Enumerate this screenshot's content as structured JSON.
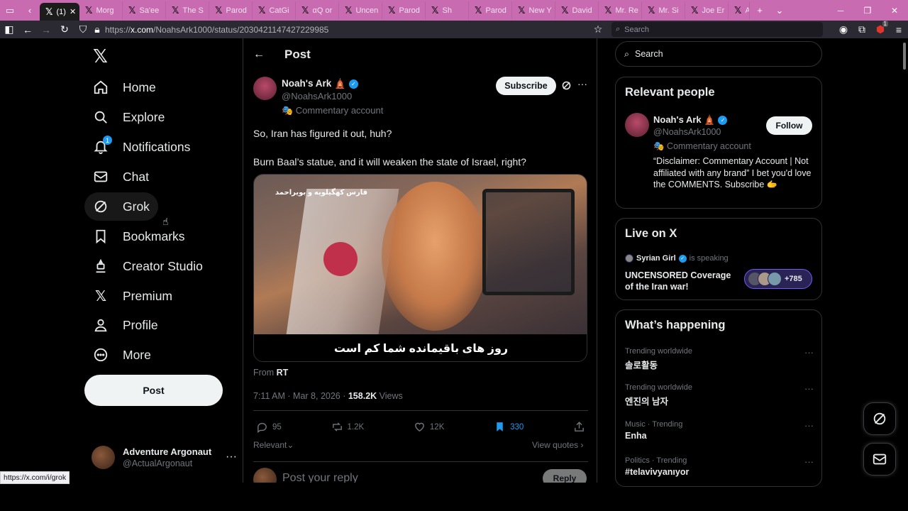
{
  "browser": {
    "active_tab_title": "(1)",
    "tabs": [
      "Morg",
      "Sa'ee",
      "The S",
      "Parod",
      "CatGi",
      "αQ or",
      "Uncen",
      "Parod",
      "Sh",
      "Parod",
      "New Y",
      "David",
      "Mr. Re",
      "Mr. Si",
      "Joe Er",
      "A"
    ],
    "url_prefix": "https://",
    "url_domain": "x.com",
    "url_path": "/NoahsArk1000/status/2030421147427229985",
    "search_placeholder": "Search",
    "status_url": "https://x.com/i/grok",
    "notification_count": "1"
  },
  "nav": {
    "home": "Home",
    "explore": "Explore",
    "notifications": "Notifications",
    "notifications_badge": "1",
    "chat": "Chat",
    "grok": "Grok",
    "bookmarks": "Bookmarks",
    "creator_studio": "Creator Studio",
    "premium": "Premium",
    "profile": "Profile",
    "more": "More",
    "post_button": "Post"
  },
  "account": {
    "name": "Adventure Argonaut",
    "handle": "@ActualArgonaut"
  },
  "post": {
    "header_title": "Post",
    "author_name": "Noah's Ark 🛕",
    "author_handle": "@NoahsArk1000",
    "author_label": "🎭 Commentary account",
    "subscribe": "Subscribe",
    "text_line1": "So, Iran has figured it out, huh?",
    "text_line2": "Burn Baal’s statue, and it will weaken the state of Israel, right?",
    "media_overlay": "فارس کهگیلویه و بویراحمد",
    "media_caption": "روز های باقیمانده شما کم است",
    "from_label": "From",
    "from_source": "RT",
    "time": "7:11 AM · Mar 8, 2026 · ",
    "views_count": "158.2K",
    "views_label": " Views",
    "replies": "95",
    "reposts": "1.2K",
    "likes": "12K",
    "bookmarks": "330",
    "relevant": "Relevant",
    "view_quotes": "View quotes",
    "reply_placeholder": "Post your reply",
    "reply_button": "Reply"
  },
  "sidebar": {
    "search_placeholder": "Search",
    "relevant_people_title": "Relevant people",
    "rp_name": "Noah's Ark 🛕",
    "rp_handle": "@NoahsArk1000",
    "rp_label": "🎭 Commentary account",
    "rp_bio": "“Disclaimer: Commentary Account | Not affiliated with any brand” I bet you'd love the COMMENTS. Subscribe 🫱",
    "follow": "Follow",
    "live_title": "Live on X",
    "live_host": "Syrian Girl",
    "live_status": "is speaking",
    "live_desc": "UNCENSORED Coverage of the Iran war!",
    "live_count": "+785",
    "happening_title": "What’s happening",
    "trends": [
      {
        "category": "Trending worldwide",
        "name": "솔로활동"
      },
      {
        "category": "Trending worldwide",
        "name": "엔진의 남자"
      },
      {
        "category": "Music · Trending",
        "name": "Enha"
      },
      {
        "category": "Politics · Trending",
        "name": "#telavivyanıyor"
      }
    ]
  },
  "colors": {
    "tabbar": "#c86bb0",
    "accent": "#1d9bf0",
    "background": "#000000"
  }
}
